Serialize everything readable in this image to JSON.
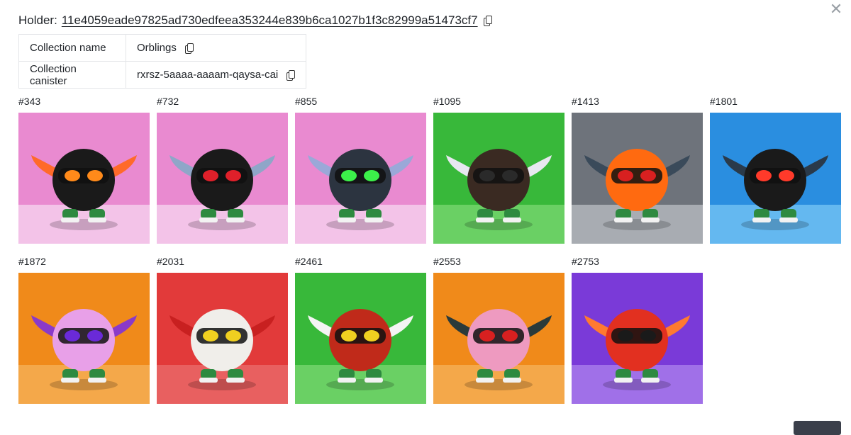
{
  "dialog": {
    "close_icon": "close-icon",
    "holder_label": "Holder:",
    "holder_id": "11e4059eade97825ad730edfeea353244e839b6ca1027b1f3c82999a51473cf7"
  },
  "info": {
    "rows": [
      {
        "key": "Collection name",
        "value": "Orblings"
      },
      {
        "key": "Collection canister",
        "value": "rxrsz-5aaaa-aaaam-qaysa-cai"
      }
    ]
  },
  "nfts": [
    {
      "label": "#343",
      "bg": "#e98ad0",
      "floor": "#f3c3e8",
      "body": "#1a1a1a",
      "eye": "#ff8a1a",
      "wing": "#ff6a2a"
    },
    {
      "label": "#732",
      "bg": "#e98ad0",
      "floor": "#f3c3e8",
      "body": "#1a1a1a",
      "eye": "#e0202a",
      "wing": "#8fa6c8"
    },
    {
      "label": "#855",
      "bg": "#e98ad0",
      "floor": "#f3c3e8",
      "body": "#2c3440",
      "eye": "#3cf04a",
      "wing": "#9aa8d8"
    },
    {
      "label": "#1095",
      "bg": "#38b83a",
      "floor": "#6ad064",
      "body": "#3a2a22",
      "eye": "#2a2a2a",
      "wing": "#e8e8f0"
    },
    {
      "label": "#1413",
      "bg": "#6e737b",
      "floor": "#a8acb2",
      "body": "#ff6a10",
      "eye": "#d82020",
      "wing": "#3a4a5a"
    },
    {
      "label": "#1801",
      "bg": "#2a8ee0",
      "floor": "#64b8f0",
      "body": "#1a1a1a",
      "eye": "#ff3a2a",
      "wing": "#2a3a4a"
    },
    {
      "label": "#1872",
      "bg": "#f08a1a",
      "floor": "#f4a84a",
      "body": "#e8a0e8",
      "eye": "#6a2ad8",
      "wing": "#8a3ac8"
    },
    {
      "label": "#2031",
      "bg": "#e23a3a",
      "floor": "#e86060",
      "body": "#f0eeea",
      "eye": "#f0d020",
      "wing": "#c82020"
    },
    {
      "label": "#2461",
      "bg": "#38b83a",
      "floor": "#6ad064",
      "body": "#c02a1a",
      "eye": "#f0d020",
      "wing": "#f4f4f4"
    },
    {
      "label": "#2553",
      "bg": "#f08a1a",
      "floor": "#f4a84a",
      "body": "#ee9ac0",
      "eye": "#d82020",
      "wing": "#2a3a3a"
    },
    {
      "label": "#2753",
      "bg": "#7a3ad8",
      "floor": "#a070e8",
      "body": "#e23020",
      "eye": "#1a1a1a",
      "wing": "#ff7a30"
    }
  ]
}
